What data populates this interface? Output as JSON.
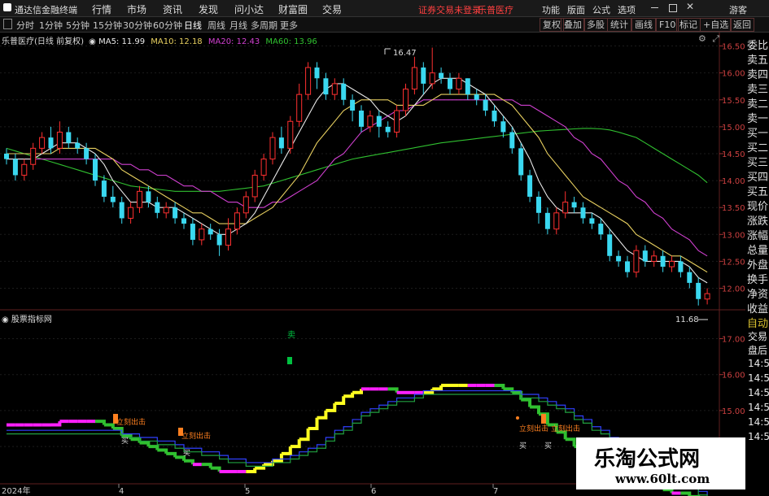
{
  "menubar": {
    "app_title": "通达信金融终端",
    "items": [
      "行情",
      "市场",
      "资讯",
      "发现",
      "问小达",
      "财富圈",
      "交易"
    ],
    "notice": "证券交易未登录",
    "stock_name": "乐普医疗",
    "right_items": [
      "功能",
      "版面",
      "公式",
      "选项"
    ],
    "guest": "游客"
  },
  "toolbar": {
    "periods": [
      "分时",
      "1分钟",
      "5分钟",
      "15分钟",
      "30分钟",
      "60分钟",
      "日线",
      "周线",
      "月线",
      "多周期",
      "更多"
    ],
    "selected": "日线",
    "buttons": [
      "复权",
      "叠加",
      "多股",
      "统计",
      "画线",
      "F10",
      "标记",
      "+自选",
      "返回"
    ]
  },
  "chart_header": {
    "title": "乐普医疗(日线 前复权)",
    "ma5": "MA5: 11.99",
    "ma10": "MA10: 12.18",
    "ma20": "MA20: 12.43",
    "ma60": "MA60: 13.96"
  },
  "indicator_header": {
    "title": "股票指标网"
  },
  "price_axis": [
    "16.50",
    "16.00",
    "15.50",
    "15.00",
    "14.50",
    "14.00",
    "13.50",
    "13.00",
    "12.50",
    "12.00"
  ],
  "indicator_axis": [
    "17.00",
    "16.00",
    "15.00",
    "14.00"
  ],
  "indicator_axis_cut": [
    "交易",
    "盘后",
    "14:50",
    "14:50",
    "14:50",
    "14:50",
    "14:50",
    "14:50"
  ],
  "right_panel": [
    "委比",
    "卖五",
    "卖四",
    "卖三",
    "卖二",
    "卖一",
    "买一",
    "买二",
    "买三",
    "买四",
    "买五",
    "现价",
    "涨跌",
    "涨幅",
    "总量",
    "外盘",
    "换手",
    "净资",
    "收益",
    "自动"
  ],
  "annotations": {
    "high_label": "16.47",
    "low_label": "11.68",
    "sell_label": "卖",
    "exit_label": "立刻出击",
    "buy_label": "买"
  },
  "date_axis": [
    "2024年",
    "4",
    "5",
    "6",
    "7"
  ],
  "watermark": {
    "title": "乐淘公式网",
    "url": "www.60lt.com"
  },
  "colors": {
    "up": "#ff3030",
    "down": "#3ad8f0",
    "ma5": "#e8e8e8",
    "ma10": "#e8d060",
    "ma20": "#d040d0",
    "ma60": "#30c030"
  },
  "chart_data": {
    "type": "candlestick",
    "ohlc": [
      [
        14.5,
        14.4,
        14.6,
        14.3
      ],
      [
        14.4,
        14.1,
        14.5,
        14.0
      ],
      [
        14.1,
        14.3,
        14.4,
        14.0
      ],
      [
        14.3,
        14.6,
        14.7,
        14.2
      ],
      [
        14.6,
        14.8,
        14.9,
        14.5
      ],
      [
        14.8,
        14.6,
        15.0,
        14.5
      ],
      [
        14.6,
        14.9,
        15.1,
        14.5
      ],
      [
        14.9,
        14.7,
        15.0,
        14.6
      ],
      [
        14.7,
        14.6,
        14.8,
        14.5
      ],
      [
        14.6,
        14.4,
        14.7,
        14.3
      ],
      [
        14.4,
        14.0,
        14.5,
        13.9
      ],
      [
        14.0,
        13.7,
        14.1,
        13.6
      ],
      [
        13.7,
        13.6,
        13.9,
        13.5
      ],
      [
        13.6,
        13.3,
        13.7,
        13.2
      ],
      [
        13.3,
        13.5,
        13.6,
        13.2
      ],
      [
        13.5,
        13.8,
        13.9,
        13.4
      ],
      [
        13.8,
        13.6,
        13.9,
        13.5
      ],
      [
        13.6,
        13.4,
        13.7,
        13.3
      ],
      [
        13.4,
        13.5,
        13.6,
        13.3
      ],
      [
        13.5,
        13.3,
        13.6,
        13.2
      ],
      [
        13.3,
        13.2,
        13.4,
        13.1
      ],
      [
        13.2,
        12.9,
        13.3,
        12.8
      ],
      [
        12.9,
        13.1,
        13.2,
        12.8
      ],
      [
        13.1,
        13.0,
        13.2,
        12.9
      ],
      [
        13.0,
        12.8,
        13.1,
        12.6
      ],
      [
        12.8,
        13.1,
        13.3,
        12.7
      ],
      [
        13.1,
        13.4,
        13.5,
        13.0
      ],
      [
        13.4,
        13.7,
        13.8,
        13.3
      ],
      [
        13.7,
        14.1,
        14.2,
        13.6
      ],
      [
        14.1,
        14.4,
        14.5,
        14.0
      ],
      [
        14.4,
        14.8,
        14.9,
        14.3
      ],
      [
        14.8,
        14.6,
        15.0,
        14.5
      ],
      [
        14.6,
        15.1,
        15.2,
        14.5
      ],
      [
        15.1,
        15.6,
        15.8,
        15.0
      ],
      [
        15.6,
        16.1,
        16.2,
        15.5
      ],
      [
        16.1,
        15.9,
        16.2,
        15.7
      ],
      [
        15.9,
        15.6,
        16.0,
        15.5
      ],
      [
        15.6,
        15.8,
        15.9,
        15.5
      ],
      [
        15.8,
        15.5,
        15.9,
        15.4
      ],
      [
        15.5,
        15.3,
        15.6,
        15.1
      ],
      [
        15.3,
        15.0,
        15.4,
        14.9
      ],
      [
        15.0,
        15.2,
        15.3,
        14.9
      ],
      [
        15.2,
        15.0,
        15.3,
        14.8
      ],
      [
        15.0,
        14.9,
        15.1,
        14.8
      ],
      [
        14.9,
        15.3,
        15.4,
        14.8
      ],
      [
        15.3,
        15.7,
        15.8,
        15.2
      ],
      [
        15.7,
        16.1,
        16.3,
        15.6
      ],
      [
        16.1,
        15.8,
        16.2,
        15.6
      ],
      [
        15.8,
        16.0,
        16.47,
        15.7
      ],
      [
        16.0,
        15.9,
        16.1,
        15.8
      ],
      [
        15.9,
        15.7,
        16.0,
        15.6
      ],
      [
        15.7,
        15.9,
        16.0,
        15.6
      ],
      [
        15.9,
        15.6,
        15.9,
        15.5
      ],
      [
        15.6,
        15.5,
        15.7,
        15.4
      ],
      [
        15.5,
        15.3,
        15.6,
        15.2
      ],
      [
        15.3,
        15.1,
        15.4,
        15.0
      ],
      [
        15.1,
        14.9,
        15.2,
        14.8
      ],
      [
        14.9,
        14.6,
        15.0,
        14.5
      ],
      [
        14.6,
        14.1,
        14.7,
        14.0
      ],
      [
        14.1,
        13.7,
        14.2,
        13.6
      ],
      [
        13.7,
        13.4,
        13.8,
        13.2
      ],
      [
        13.4,
        13.1,
        13.5,
        13.0
      ],
      [
        13.1,
        13.4,
        13.5,
        13.0
      ],
      [
        13.4,
        13.6,
        13.8,
        13.3
      ],
      [
        13.6,
        13.5,
        13.7,
        13.4
      ],
      [
        13.5,
        13.3,
        13.6,
        13.2
      ],
      [
        13.3,
        13.2,
        13.4,
        13.1
      ],
      [
        13.2,
        13.0,
        13.3,
        12.9
      ],
      [
        13.0,
        12.6,
        13.1,
        12.5
      ],
      [
        12.6,
        12.5,
        12.7,
        12.4
      ],
      [
        12.5,
        12.3,
        12.6,
        12.2
      ],
      [
        12.3,
        12.7,
        12.8,
        12.2
      ],
      [
        12.7,
        12.5,
        12.8,
        12.4
      ],
      [
        12.5,
        12.6,
        12.7,
        12.4
      ],
      [
        12.6,
        12.4,
        12.7,
        12.3
      ],
      [
        12.4,
        12.5,
        12.6,
        12.3
      ],
      [
        12.5,
        12.3,
        12.6,
        12.2
      ],
      [
        12.3,
        12.1,
        12.4,
        12.0
      ],
      [
        12.1,
        11.8,
        12.2,
        11.68
      ],
      [
        11.8,
        11.9,
        12.0,
        11.7
      ]
    ],
    "ma5": [
      14.4,
      14.4,
      14.4,
      14.4,
      14.5,
      14.6,
      14.7,
      14.7,
      14.7,
      14.6,
      14.5,
      14.3,
      14.0,
      13.8,
      13.6,
      13.6,
      13.6,
      13.5,
      13.5,
      13.5,
      13.4,
      13.3,
      13.2,
      13.1,
      13.0,
      13.0,
      13.1,
      13.2,
      13.4,
      13.7,
      14.0,
      14.3,
      14.6,
      14.9,
      15.2,
      15.5,
      15.7,
      15.8,
      15.8,
      15.7,
      15.6,
      15.5,
      15.3,
      15.2,
      15.1,
      15.2,
      15.4,
      15.6,
      15.8,
      15.9,
      15.9,
      15.9,
      15.8,
      15.7,
      15.6,
      15.4,
      15.2,
      15.0,
      14.7,
      14.4,
      14.0,
      13.7,
      13.5,
      13.4,
      13.4,
      13.4,
      13.4,
      13.3,
      13.1,
      12.9,
      12.7,
      12.6,
      12.5,
      12.5,
      12.5,
      12.5,
      12.5,
      12.4,
      12.2,
      12.1
    ],
    "ma10": [
      14.5,
      14.5,
      14.5,
      14.5,
      14.5,
      14.5,
      14.6,
      14.6,
      14.6,
      14.6,
      14.6,
      14.5,
      14.4,
      14.2,
      14.1,
      14.0,
      13.9,
      13.8,
      13.7,
      13.6,
      13.5,
      13.4,
      13.4,
      13.3,
      13.2,
      13.2,
      13.2,
      13.2,
      13.3,
      13.4,
      13.5,
      13.7,
      13.9,
      14.1,
      14.4,
      14.7,
      14.9,
      15.1,
      15.3,
      15.4,
      15.5,
      15.5,
      15.5,
      15.5,
      15.4,
      15.4,
      15.4,
      15.4,
      15.5,
      15.6,
      15.6,
      15.6,
      15.6,
      15.6,
      15.6,
      15.6,
      15.5,
      15.4,
      15.2,
      15.0,
      14.8,
      14.5,
      14.3,
      14.1,
      13.9,
      13.7,
      13.6,
      13.5,
      13.4,
      13.3,
      13.2,
      13.0,
      12.9,
      12.8,
      12.7,
      12.6,
      12.6,
      12.5,
      12.4,
      12.3
    ],
    "ma20": [
      14.4,
      14.4,
      14.4,
      14.4,
      14.4,
      14.4,
      14.4,
      14.4,
      14.4,
      14.4,
      14.4,
      14.4,
      14.4,
      14.3,
      14.3,
      14.2,
      14.2,
      14.1,
      14.1,
      14.0,
      13.9,
      13.9,
      13.8,
      13.8,
      13.7,
      13.6,
      13.6,
      13.5,
      13.5,
      13.5,
      13.6,
      13.6,
      13.7,
      13.8,
      13.9,
      14.0,
      14.2,
      14.4,
      14.5,
      14.7,
      14.9,
      15.0,
      15.1,
      15.2,
      15.3,
      15.3,
      15.4,
      15.5,
      15.5,
      15.5,
      15.5,
      15.5,
      15.5,
      15.5,
      15.5,
      15.5,
      15.5,
      15.5,
      15.4,
      15.4,
      15.3,
      15.2,
      15.1,
      15.0,
      14.8,
      14.7,
      14.5,
      14.4,
      14.2,
      14.0,
      13.9,
      13.7,
      13.6,
      13.4,
      13.3,
      13.1,
      13.0,
      12.9,
      12.7,
      12.6
    ],
    "ma60": [
      14.6,
      14.55,
      14.5,
      14.45,
      14.4,
      14.35,
      14.3,
      14.25,
      14.2,
      14.15,
      14.1,
      14.05,
      14.0,
      13.95,
      13.9,
      13.88,
      13.86,
      13.84,
      13.82,
      13.8,
      13.8,
      13.8,
      13.8,
      13.8,
      13.8,
      13.82,
      13.84,
      13.86,
      13.88,
      13.9,
      13.95,
      14.0,
      14.05,
      14.1,
      14.15,
      14.2,
      14.25,
      14.3,
      14.35,
      14.4,
      14.43,
      14.46,
      14.49,
      14.52,
      14.55,
      14.58,
      14.61,
      14.64,
      14.67,
      14.7,
      14.72,
      14.74,
      14.76,
      14.78,
      14.8,
      14.82,
      14.84,
      14.86,
      14.88,
      14.9,
      14.92,
      14.93,
      14.94,
      14.95,
      14.96,
      14.97,
      14.97,
      14.96,
      14.94,
      14.9,
      14.85,
      14.8,
      14.7,
      14.6,
      14.5,
      14.4,
      14.3,
      14.2,
      14.1,
      13.96
    ],
    "ylim": [
      11.6,
      16.75
    ]
  }
}
